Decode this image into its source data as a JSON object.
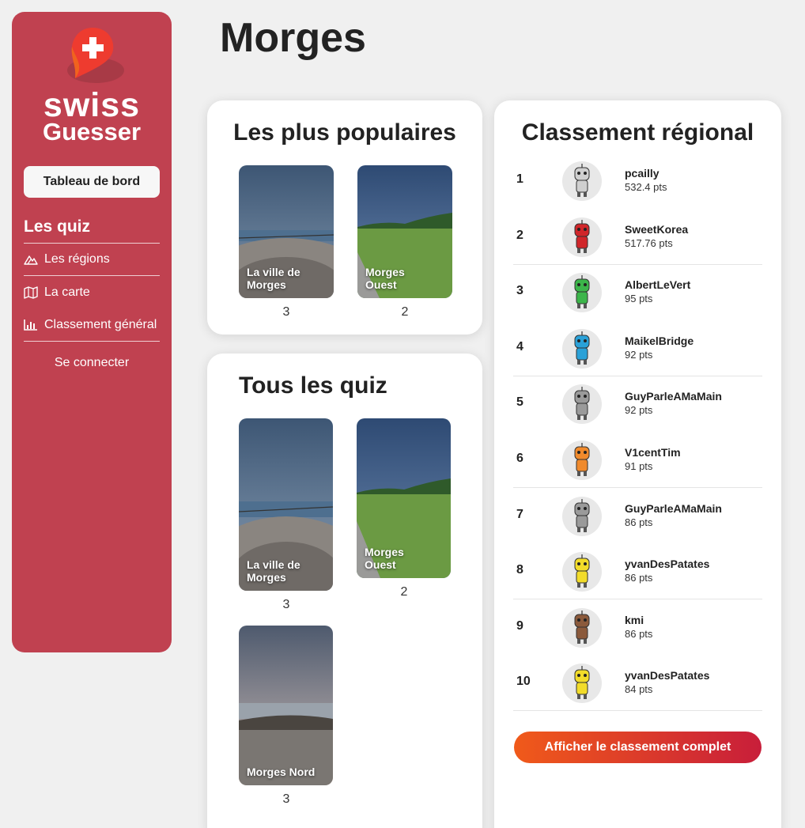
{
  "sidebar": {
    "logo_line1": "swiss",
    "logo_line2": "Guesser",
    "dashboard_label": "Tableau de bord",
    "section_title": "Les quiz",
    "items": [
      {
        "label": "Les régions",
        "icon": "mountain-icon"
      },
      {
        "label": "La carte",
        "icon": "map-icon"
      },
      {
        "label": "Classement général",
        "icon": "bar-chart-icon"
      }
    ],
    "login_label": "Se connecter"
  },
  "page": {
    "title": "Morges"
  },
  "popular": {
    "title": "Les plus populaires",
    "quizzes": [
      {
        "label": "La ville de Morges",
        "count": "3"
      },
      {
        "label": "Morges Ouest",
        "count": "2"
      }
    ]
  },
  "all_quizzes": {
    "title": "Tous les quiz",
    "quizzes": [
      {
        "label": "La ville de Morges",
        "count": "3"
      },
      {
        "label": "Morges Ouest",
        "count": "2"
      },
      {
        "label": "Morges Nord",
        "count": "3"
      }
    ]
  },
  "ranking": {
    "title": "Classement régional",
    "rows": [
      {
        "rank": "1",
        "name": "pcailly",
        "points": "532.4 pts",
        "avatar_color": "#cfcfcf"
      },
      {
        "rank": "2",
        "name": "SweetKorea",
        "points": "517.76 pts",
        "avatar_color": "#d0262a"
      },
      {
        "rank": "3",
        "name": "AlbertLeVert",
        "points": "95 pts",
        "avatar_color": "#3cb54a"
      },
      {
        "rank": "4",
        "name": "MaikelBridge",
        "points": "92 pts",
        "avatar_color": "#2aa1d8"
      },
      {
        "rank": "5",
        "name": "GuyParleAMaMain",
        "points": "92 pts",
        "avatar_color": "#9a9a9a"
      },
      {
        "rank": "6",
        "name": "V1centTim",
        "points": "91 pts",
        "avatar_color": "#f08a2c"
      },
      {
        "rank": "7",
        "name": "GuyParleAMaMain",
        "points": "86 pts",
        "avatar_color": "#9a9a9a"
      },
      {
        "rank": "8",
        "name": "yvanDesPatates",
        "points": "86 pts",
        "avatar_color": "#f2dc2a"
      },
      {
        "rank": "9",
        "name": "kmi",
        "points": "86 pts",
        "avatar_color": "#8b5a3c"
      },
      {
        "rank": "10",
        "name": "yvanDesPatates",
        "points": "84 pts",
        "avatar_color": "#f2dc2a"
      }
    ],
    "full_button_label": "Afficher le classement complet"
  },
  "colors": {
    "sidebar": "#c04150",
    "button_gradient_start": "#f05a1a",
    "button_gradient_end": "#c81e3a"
  }
}
